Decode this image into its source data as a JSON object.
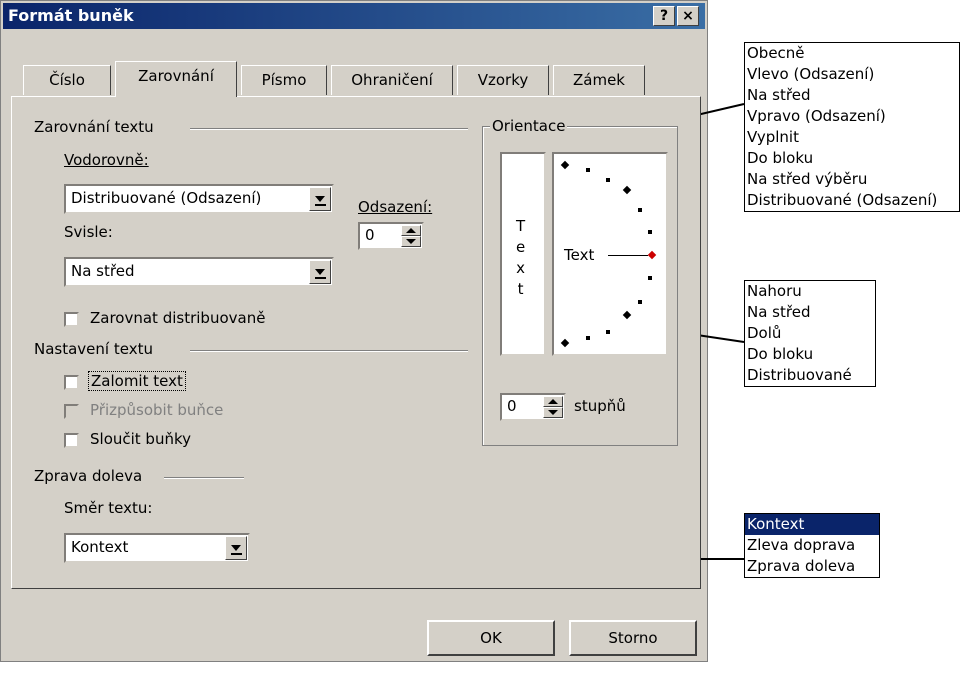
{
  "dialog": {
    "title": "Formát buněk",
    "help_label": "?",
    "close_label": "×"
  },
  "tabs": [
    {
      "label": "Číslo"
    },
    {
      "label": "Zarovnání"
    },
    {
      "label": "Písmo"
    },
    {
      "label": "Ohraničení"
    },
    {
      "label": "Vzorky"
    },
    {
      "label": "Zámek"
    }
  ],
  "alignment": {
    "group_label": "Zarovnání textu",
    "horizontal_label": "Vodorovně:",
    "horizontal_value": "Distribuované (Odsazení)",
    "vertical_label": "Svisle:",
    "vertical_value": "Na střed",
    "indent_label": "Odsazení:",
    "indent_value": "0",
    "distribute_label": "Zarovnat distribuovaně"
  },
  "text_control": {
    "group_label": "Nastavení textu",
    "wrap_label": "Zalomit text",
    "shrink_label": "Přizpůsobit buňce",
    "merge_label": "Sloučit buňky"
  },
  "rtl": {
    "group_label": "Zprava doleva",
    "direction_label": "Směr textu:",
    "direction_value": "Kontext"
  },
  "orientation": {
    "group_label": "Orientace",
    "vertical_text": [
      "T",
      "e",
      "x",
      "t"
    ],
    "dial_text": "Text",
    "degrees_value": "0",
    "degrees_label": "stupňů",
    "accent_color": "#cc0000"
  },
  "buttons": {
    "ok": "OK",
    "cancel": "Storno"
  },
  "callouts": {
    "horizontal_options": [
      "Obecně",
      "Vlevo (Odsazení)",
      "Na střed",
      "Vpravo (Odsazení)",
      "Vyplnit",
      "Do bloku",
      "Na střed výběru",
      "Distribuované (Odsazení)"
    ],
    "vertical_options": [
      "Nahoru",
      "Na střed",
      "Dolů",
      "Do bloku",
      "Distribuované"
    ],
    "direction_options": [
      "Kontext",
      "Zleva doprava",
      "Zprava doleva"
    ],
    "selected_color": "#0a246a"
  }
}
